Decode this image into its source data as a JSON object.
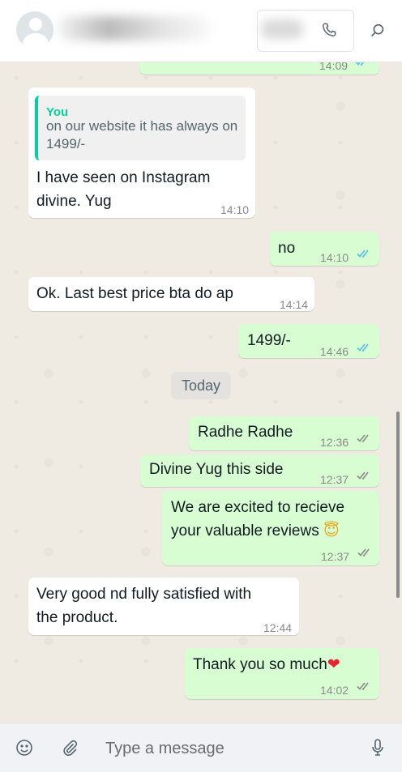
{
  "header": {
    "contact_name": "",
    "call_icon": "phone-icon",
    "search_icon": "search-icon"
  },
  "messages": [
    {
      "direction": "out",
      "partial": true,
      "time": "14:09",
      "status": "read"
    },
    {
      "direction": "in",
      "quote": {
        "author": "You",
        "text": "on our website it has always on 1499/-"
      },
      "line1": "I have seen on Instagram",
      "line2": "divine. Yug",
      "time": "14:10"
    },
    {
      "direction": "out",
      "text": "no",
      "time": "14:10",
      "status": "read"
    },
    {
      "direction": "in",
      "text": "Ok. Last best price bta do ap",
      "time": "14:14"
    },
    {
      "direction": "out",
      "text": "1499/-",
      "time": "14:46",
      "status": "read"
    },
    {
      "divider": "Today"
    },
    {
      "direction": "out",
      "text": "Radhe Radhe",
      "time": "12:36",
      "status": "delivered"
    },
    {
      "direction": "out",
      "text": "Divine Yug this side",
      "time": "12:37",
      "status": "delivered"
    },
    {
      "direction": "out",
      "line1": "We are excited to recieve",
      "line2": "your valuable reviews",
      "emoji": "😇",
      "time": "12:37",
      "status": "delivered"
    },
    {
      "direction": "in",
      "line1": "Very good nd fully satisfied with",
      "line2": "the product.",
      "time": "12:44"
    },
    {
      "direction": "out",
      "text": "Thank you so much",
      "emoji": "❤",
      "time": "14:02",
      "status": "delivered"
    }
  ],
  "composer": {
    "placeholder": "Type a message",
    "emoji_icon": "emoji-icon",
    "attach_icon": "paperclip-icon",
    "mic_icon": "microphone-icon"
  },
  "colors": {
    "incoming_bubble": "#ffffff",
    "outgoing_bubble": "#d9fdd3",
    "read_tick": "#53bdeb",
    "quote_accent": "#06cf9c",
    "wallpaper": "#efeae2"
  }
}
